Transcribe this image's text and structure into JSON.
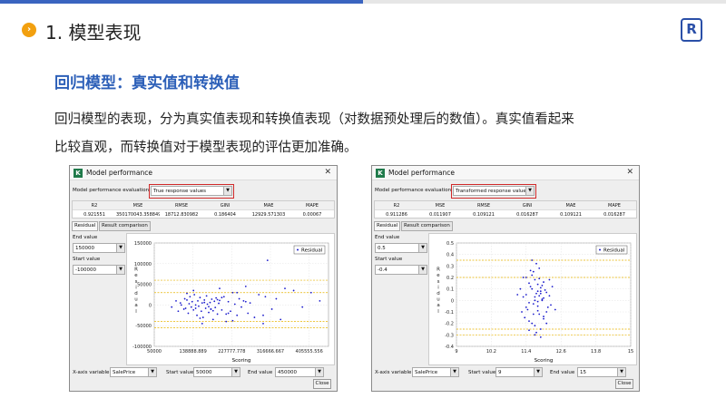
{
  "slide": {
    "heading": "1. 模型表现",
    "bullet_icon": "chevron-right-icon",
    "logo_letter": "R",
    "subheading": "回归模型：真实值和转换值",
    "para_line1": "回归模型的表现，分为真实值表现和转换值表现（对数据预处理后的数值）。真实值看起来",
    "para_line2": "比较直观，而转换值对于模型表现的评估更加准确。",
    "colors": {
      "accent": "#3a64c0",
      "subheading": "#2c5fb8",
      "bullet": "#f2a00f",
      "highlight": "#d12a2a"
    }
  },
  "windows": [
    {
      "title": "Model performance",
      "close_glyph": "✕",
      "eval_label": "Model performance evaluation type",
      "eval_value": "True response values",
      "metrics_headers": [
        "R2",
        "MSE",
        "RMSE",
        "GINI",
        "MAE",
        "MAPE"
      ],
      "metrics_values": [
        "0.921551",
        "350170043.358849",
        "18712.830982",
        "0.186404",
        "12929.571303",
        "0.00067"
      ],
      "tabs": [
        "Residual",
        "Result comparison"
      ],
      "end_label": "End value",
      "end_value": "150000",
      "start_label": "Start value",
      "start_value": "-100000",
      "x_var_label": "X-axis variable",
      "x_var_value": "SalePrice",
      "bottom_start_label": "Start value",
      "bottom_start_value": "50000",
      "bottom_end_label": "End value",
      "bottom_end_value": "450000",
      "close_button": "Close"
    },
    {
      "title": "Model performance",
      "close_glyph": "✕",
      "eval_label": "Model performance evaluation type",
      "eval_value": "Transformed response values",
      "metrics_headers": [
        "R2",
        "MSE",
        "RMSE",
        "GINI",
        "MAE",
        "MAPE"
      ],
      "metrics_values": [
        "0.911286",
        "0.011907",
        "0.109121",
        "0.016287",
        "0.109121",
        "0.016287"
      ],
      "tabs": [
        "Residual",
        "Result comparison"
      ],
      "end_label": "End value",
      "end_value": "0.5",
      "start_label": "Start value",
      "start_value": "-0.4",
      "x_var_label": "X-axis variable",
      "x_var_value": "SalePrice",
      "bottom_start_label": "Start value",
      "bottom_start_value": "9",
      "bottom_end_label": "End value",
      "bottom_end_value": "15",
      "close_button": "Close"
    }
  ],
  "chart_data": [
    {
      "type": "scatter",
      "title": "",
      "xlabel": "Scoring",
      "ylabel": "Residual",
      "legend": [
        "Residual"
      ],
      "legend_placement": "top-right",
      "xlim": [
        50000,
        450000
      ],
      "ylim": [
        -100000,
        150000
      ],
      "x_ticks": [
        "50000",
        "138888.889",
        "227777.778",
        "316666.667",
        "405555.556"
      ],
      "y_ticks": [
        "150000",
        "100000",
        "50000",
        "0",
        "-50000",
        "-100000"
      ],
      "threshold_lines": [
        60000,
        30000,
        -40000,
        -55000
      ],
      "grid": true,
      "series": [
        {
          "name": "Residual",
          "color": "#1a1acc",
          "x": [
            90000,
            100000,
            105000,
            110000,
            112000,
            118000,
            120000,
            122000,
            125000,
            128000,
            130000,
            132000,
            135000,
            137000,
            140000,
            142000,
            145000,
            148000,
            150000,
            152000,
            155000,
            158000,
            160000,
            162000,
            165000,
            168000,
            170000,
            172000,
            175000,
            178000,
            180000,
            182000,
            185000,
            188000,
            190000,
            192000,
            195000,
            198000,
            200000,
            205000,
            210000,
            215000,
            220000,
            225000,
            230000,
            235000,
            240000,
            245000,
            250000,
            255000,
            260000,
            265000,
            270000,
            280000,
            290000,
            300000,
            305000,
            310000,
            320000,
            330000,
            340000,
            350000,
            370000,
            390000,
            410000,
            430000,
            140000,
            160000,
            180000,
            200000,
            220000,
            145000,
            165000,
            185000,
            205000,
            125000,
            155000,
            175000,
            195000,
            215000,
            300000,
            260000,
            240000,
            230000
          ],
          "y": [
            -5000,
            10000,
            -15000,
            5000,
            0,
            -10000,
            15000,
            -8000,
            12000,
            -20000,
            3000,
            20000,
            -5000,
            8000,
            -12000,
            25000,
            0,
            -25000,
            10000,
            -3000,
            18000,
            -15000,
            5000,
            -30000,
            12000,
            -8000,
            22000,
            2000,
            -18000,
            6000,
            -10000,
            14000,
            -35000,
            9000,
            -6000,
            17000,
            -22000,
            4000,
            11000,
            -12000,
            20000,
            -40000,
            8000,
            -15000,
            30000,
            2000,
            -25000,
            15000,
            -5000,
            10000,
            45000,
            -20000,
            5000,
            -30000,
            25000,
            -45000,
            20000,
            108000,
            -10000,
            15000,
            -35000,
            40000,
            35000,
            -5000,
            30000,
            10000,
            35000,
            -45000,
            -10000,
            40000,
            -20000,
            -8000,
            6000,
            -14000,
            18000,
            28000,
            -32000,
            -4000,
            13000,
            -22000,
            -25000,
            8000,
            30000,
            -38000
          ]
        }
      ]
    },
    {
      "type": "scatter",
      "title": "",
      "xlabel": "Scoring",
      "ylabel": "Residual",
      "legend": [
        "Residual"
      ],
      "legend_placement": "top-right",
      "xlim": [
        9,
        15
      ],
      "ylim": [
        -0.4,
        0.5
      ],
      "x_ticks": [
        "9",
        "10.2",
        "11.4",
        "12.6",
        "13.8",
        "15"
      ],
      "y_ticks": [
        "0.5",
        "0.4",
        "0.3",
        "0.2",
        "0.1",
        "0",
        "-0.1",
        "-0.2",
        "-0.3",
        "-0.4"
      ],
      "threshold_lines": [
        0.35,
        0.2,
        -0.3,
        -0.25
      ],
      "grid": true,
      "series": [
        {
          "name": "Residual",
          "color": "#1a1acc",
          "x": [
            11.4,
            11.5,
            11.6,
            11.7,
            11.8,
            11.9,
            12.0,
            12.1,
            12.2,
            11.45,
            11.55,
            11.65,
            11.75,
            11.85,
            11.95,
            12.05,
            12.15,
            11.3,
            11.35,
            11.5,
            11.6,
            11.7,
            11.8,
            11.9,
            12.0,
            12.1,
            12.25,
            11.4,
            11.5,
            11.6,
            11.7,
            11.8,
            11.9,
            12.0,
            11.2,
            11.25,
            11.65,
            11.75,
            11.85,
            11.95,
            12.3,
            12.4,
            11.1,
            11.55,
            11.7,
            11.85,
            12.0,
            11.6,
            11.75,
            11.9,
            11.5,
            11.8,
            12.2,
            11.4,
            11.95,
            11.65,
            11.85,
            11.3,
            12.1,
            11.7,
            11.8,
            11.9
          ],
          "y": [
            0.05,
            -0.02,
            0.1,
            0.0,
            -0.05,
            0.08,
            0.02,
            -0.1,
            0.04,
            -0.08,
            0.12,
            -0.03,
            0.06,
            -0.12,
            0.01,
            0.09,
            -0.06,
            0.03,
            -0.15,
            0.15,
            -0.2,
            0.18,
            -0.09,
            0.11,
            -0.14,
            0.07,
            -0.04,
            0.2,
            -0.18,
            0.22,
            -0.22,
            0.14,
            -0.25,
            0.16,
            0.1,
            -0.1,
            0.25,
            -0.28,
            0.28,
            0.0,
            0.12,
            -0.08,
            0.05,
            0.26,
            -0.3,
            0.19,
            -0.16,
            0.35,
            0.32,
            -0.32,
            -0.26,
            0.08,
            0.18,
            -0.06,
            0.13,
            -0.12,
            0.04,
            0.2,
            -0.2,
            0.03,
            -0.01,
            0.06
          ]
        }
      ]
    }
  ]
}
